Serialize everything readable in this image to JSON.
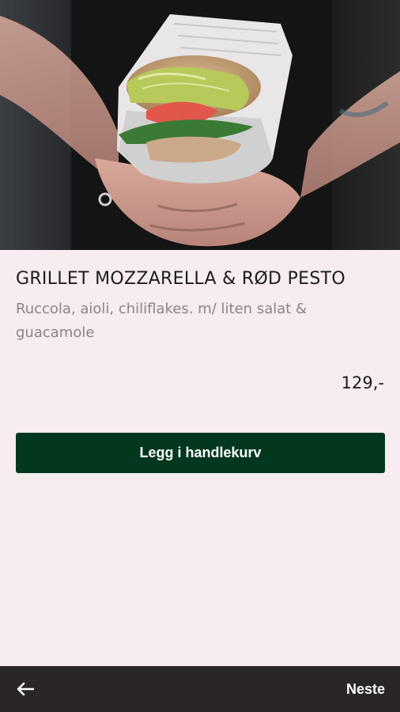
{
  "product": {
    "title": "GRILLET MOZZARELLA & RØD PESTO",
    "description": "Ruccola, aioli, chiliflakes. m/ liten salat & guacamole",
    "price": "129,-",
    "image_icon": "sandwich-photo"
  },
  "actions": {
    "add_to_cart_label": "Legg i handlekurv"
  },
  "bottom_nav": {
    "back_icon": "arrow-left-icon",
    "next_label": "Neste"
  },
  "colors": {
    "background": "#f7ecef",
    "primary_button": "#03381e",
    "bottom_bar": "#2a2627",
    "title_text": "#1c1c1c",
    "description_text": "#8a8587"
  }
}
